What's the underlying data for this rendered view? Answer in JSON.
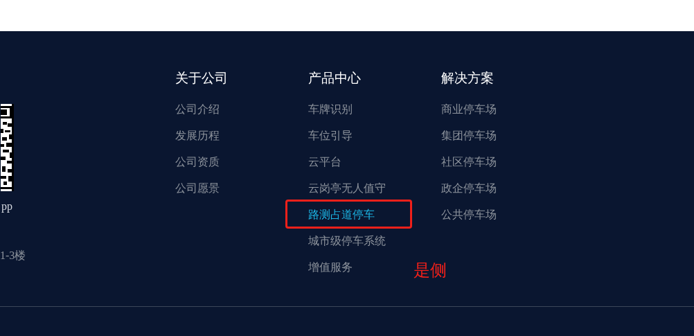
{
  "left_column": {
    "qr_caption": "pp",
    "address": "1-3楼"
  },
  "columns": [
    {
      "heading": "关于公司",
      "items": [
        {
          "label": "公司介绍",
          "selected": false,
          "boxed": false
        },
        {
          "label": "发展历程",
          "selected": false,
          "boxed": false
        },
        {
          "label": "公司资质",
          "selected": false,
          "boxed": false
        },
        {
          "label": "公司愿景",
          "selected": false,
          "boxed": false
        }
      ]
    },
    {
      "heading": "产品中心",
      "items": [
        {
          "label": "车牌识别",
          "selected": false,
          "boxed": false
        },
        {
          "label": "车位引导",
          "selected": false,
          "boxed": false
        },
        {
          "label": "云平台",
          "selected": false,
          "boxed": false
        },
        {
          "label": "云岗亭无人值守",
          "selected": false,
          "boxed": false
        },
        {
          "label": "路测占道停车",
          "selected": true,
          "boxed": true
        },
        {
          "label": "城市级停车系统",
          "selected": false,
          "boxed": false
        },
        {
          "label": "增值服务",
          "selected": false,
          "boxed": false
        }
      ]
    },
    {
      "heading": "解决方案",
      "items": [
        {
          "label": "商业停车场",
          "selected": false,
          "boxed": false
        },
        {
          "label": "集团停车场",
          "selected": false,
          "boxed": false
        },
        {
          "label": "社区停车场",
          "selected": false,
          "boxed": false
        },
        {
          "label": "政企停车场",
          "selected": false,
          "boxed": false
        },
        {
          "label": "公共停车场",
          "selected": false,
          "boxed": false
        }
      ]
    }
  ],
  "annotation": {
    "text": "是侧"
  }
}
